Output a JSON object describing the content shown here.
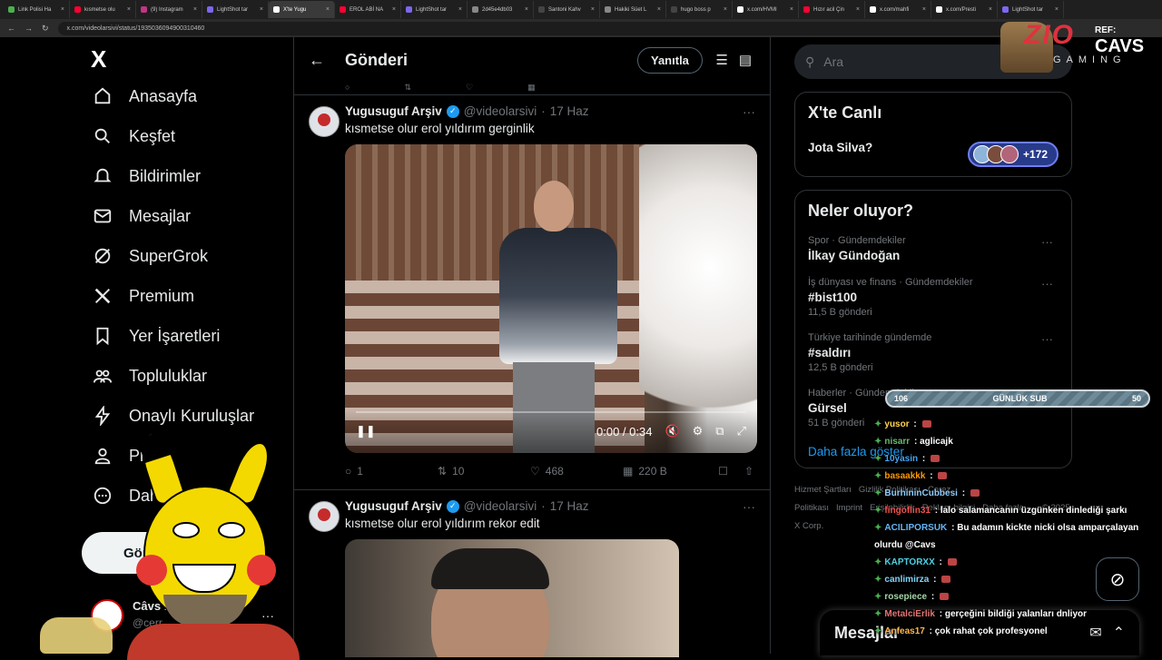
{
  "browser": {
    "tabs": [
      {
        "label": "Link Polisi Ha",
        "color": "#4caf50"
      },
      {
        "label": "kısmetse olu",
        "color": "#ff0033"
      },
      {
        "label": "(9) Instagram",
        "color": "#c13584"
      },
      {
        "label": "LightShot tar",
        "color": "#7b68ee"
      },
      {
        "label": "X'te Yugu",
        "color": "#ffffff",
        "active": true
      },
      {
        "label": "EROL ABİ NA",
        "color": "#ff0033"
      },
      {
        "label": "LightShot tar",
        "color": "#7b68ee"
      },
      {
        "label": "2d45e4db03",
        "color": "#888888"
      },
      {
        "label": "Santoni Kahv",
        "color": "#444444"
      },
      {
        "label": "Hakiki Süet L",
        "color": "#888888"
      },
      {
        "label": "hugo boss p",
        "color": "#444444"
      },
      {
        "label": "x.com/HVMI",
        "color": "#ffffff"
      },
      {
        "label": "Hızır acil Çin",
        "color": "#ff0033"
      },
      {
        "label": "x.com/mahfi",
        "color": "#ffffff"
      },
      {
        "label": "x.com/Presti",
        "color": "#ffffff"
      },
      {
        "label": "LightShot tar",
        "color": "#7b68ee"
      }
    ],
    "url": "x.com/videolarsivi/status/1935036094900310460"
  },
  "nav": {
    "logo": "X",
    "items": [
      {
        "label": "Anasayfa",
        "icon": "home-icon"
      },
      {
        "label": "Keşfet",
        "icon": "search-icon"
      },
      {
        "label": "Bildirimler",
        "icon": "bell-icon"
      },
      {
        "label": "Mesajlar",
        "icon": "mail-icon"
      },
      {
        "label": "SuperGrok",
        "icon": "grok-icon"
      },
      {
        "label": "Premium",
        "icon": "x-icon"
      },
      {
        "label": "Yer İşaretleri",
        "icon": "bookmark-icon"
      },
      {
        "label": "Topluluklar",
        "icon": "communities-icon"
      },
      {
        "label": "Onaylı Kuruluşlar",
        "icon": "lightning-icon"
      },
      {
        "label": "Profil",
        "icon": "person-icon"
      },
      {
        "label": "Daha fazla",
        "icon": "more-circle-icon"
      }
    ],
    "post_button": "Gönderi yayınla",
    "user": {
      "name": "Câvs K",
      "handle": "@cerr"
    }
  },
  "main": {
    "header_title": "Gönderi",
    "reply_button": "Yanıtla",
    "tweets": [
      {
        "name": "Yugusuguf Arşiv",
        "handle": "@videolarsivi",
        "date": "17 Haz",
        "text": "kısmetse olur erol yıldırım gerginlik",
        "video_time": "0:00 / 0:34",
        "replies": "1",
        "reposts": "10",
        "likes": "468",
        "views": "220 B"
      },
      {
        "name": "Yugusuguf Arşiv",
        "handle": "@videolarsivi",
        "date": "17 Haz",
        "text": "kısmetse olur erol yıldırım rekor edit"
      }
    ]
  },
  "sidebar": {
    "search_placeholder": "Ara",
    "live": {
      "title": "X'te Canlı",
      "subject": "Jota Silva?",
      "count": "+172"
    },
    "trends_title": "Neler oluyor?",
    "trends": [
      {
        "meta": "Spor · Gündemdekiler",
        "title": "İlkay Gündoğan",
        "count": ""
      },
      {
        "meta": "İş dünyası ve finans · Gündemdekiler",
        "title": "#bist100",
        "count": "11,5 B gönderi"
      },
      {
        "meta": "Türkiye tarihinde gündemde",
        "title": "#saldırı",
        "count": "12,5 B gönderi"
      },
      {
        "meta": "Haberler · Gündemdekiler",
        "title": "Gürsel",
        "count": "51 B gönderi"
      }
    ],
    "more_link": "Daha fazla göster",
    "footer": [
      "Hizmet Şartları",
      "Gizlilik Politikası",
      "Çerez Politikası",
      "Imprint",
      "Erişilebilirlik",
      "Reklam bilgisi",
      "Daha fazla ···",
      "© 2025 X Corp."
    ]
  },
  "messages": {
    "label": "Mesajlar"
  },
  "stream_overlay": {
    "brand": "ZIO",
    "brand_sub": "GAMING",
    "ref_label": "REF:",
    "ref_name": "CAVS",
    "sub_goal": {
      "current": "106",
      "label": "GÜNLÜK SUB",
      "target": "50"
    },
    "chat": [
      {
        "user": "yusor",
        "msg": "",
        "color": "#ffd54f"
      },
      {
        "user": "nisarr",
        "msg": "aglicajk",
        "color": "#66bb6a"
      },
      {
        "user": "10yasin",
        "msg": "",
        "color": "#42a5f5"
      },
      {
        "user": "basaakkk",
        "msg": "",
        "color": "#ff9800"
      },
      {
        "user": "BurhininCubbesi",
        "msg": "",
        "color": "#90caf9"
      },
      {
        "user": "fingoflin31",
        "msg": "lalo salamancanın üzgünken dinlediği şarkı",
        "color": "#ef5350"
      },
      {
        "user": "ACILIPORSUK",
        "msg": "Bu adamın kickte nicki olsa amparçalayan olurdu @Cavs",
        "color": "#64b5f6"
      },
      {
        "user": "KAPTORXX",
        "msg": "",
        "color": "#4dd0e1"
      },
      {
        "user": "canlimirza",
        "msg": "",
        "color": "#81d4fa"
      },
      {
        "user": "rosepiece",
        "msg": "",
        "color": "#a5d6a7"
      },
      {
        "user": "MetalciErlik",
        "msg": "gerçeğini bildiği yalanları dnliyor",
        "color": "#e57373"
      },
      {
        "user": "Anfeas17",
        "msg": "çok rahat çok profesyonel",
        "color": "#ffb74d"
      }
    ]
  }
}
